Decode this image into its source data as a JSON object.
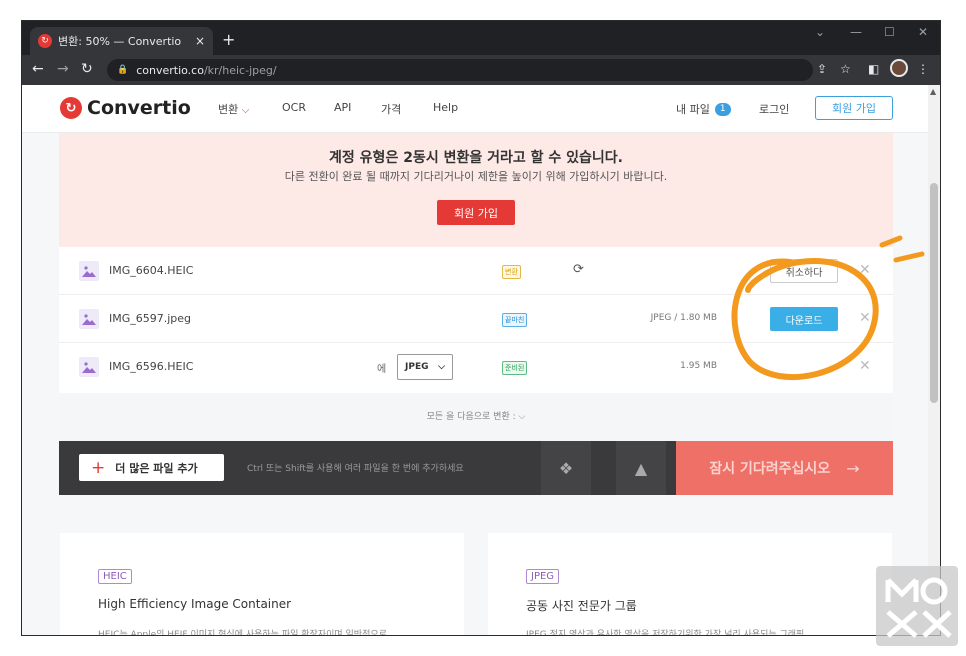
{
  "browser": {
    "tab_title": "변환: 50% — Convertio",
    "tab_close": "×",
    "new_tab": "+",
    "url_host": "convertio.co",
    "url_path": "/kr/heic-jpeg/"
  },
  "site": {
    "logo_text": "Convertio",
    "menu": {
      "convert": "변환",
      "ocr": "OCR",
      "api": "API",
      "pricing": "가격",
      "help": "Help"
    },
    "my_files": "내 파일",
    "my_files_count": "1",
    "login": "로그인",
    "signup": "회원 가입"
  },
  "alert": {
    "heading": "계정 유형은 2동시 변환을 거라고 할 수 있습니다.",
    "sub": "다른 전환이 완료 될 때까지 기다리거나이 제한을 높이기 위해 가입하시기 바랍니다.",
    "button": "회원 가입"
  },
  "files": [
    {
      "name": "IMG_6604.HEIC",
      "status": "변환",
      "size": "",
      "action": "취소하다"
    },
    {
      "name": "IMG_6597.jpeg",
      "status": "끝마친",
      "size": "JPEG / 1.80 MB",
      "action": "다운로드"
    },
    {
      "name": "IMG_6596.HEIC",
      "status": "준비된",
      "size": "1.95 MB",
      "to_label": "에",
      "format": "JPEG"
    }
  ],
  "convert_all": "모든 을 다음으로 변환 :",
  "actions": {
    "add_files": "더 많은 파일 추가",
    "hint": "Ctrl 또는 Shift를 사용해 여러 파일을 한 번에 추가하세요",
    "wait_button": "잠시 기다려주십시오",
    "arrow": "→"
  },
  "info": [
    {
      "tag": "HEIC",
      "title": "High Efficiency Image Container",
      "desc": "HEIC는 Apple의 HEIF 이미지 형식에 사용하는 파일 확장자이며 일반적으로"
    },
    {
      "tag": "JPEG",
      "title": "공동 사진 전문가 그룹",
      "desc": "JPEG 정지 영상과 유사한 영상을 저장하기위한 가장 널리 사용되는 그래픽"
    }
  ],
  "colors": {
    "brand_red": "#e53935",
    "accent_blue": "#3b9fe0",
    "annotation_orange": "#f39a1e"
  }
}
